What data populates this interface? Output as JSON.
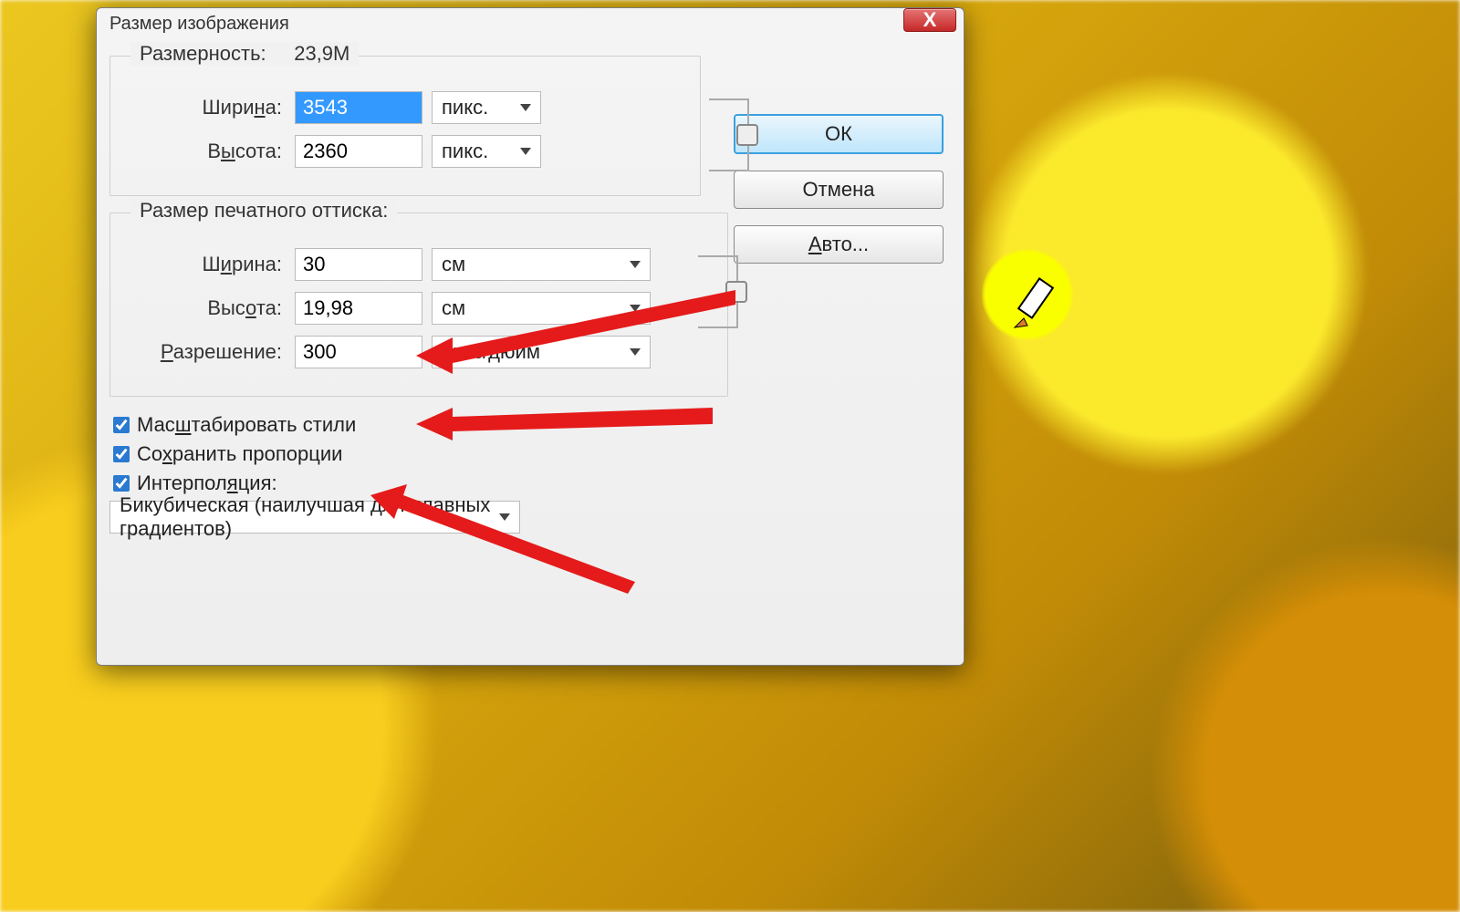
{
  "dialog": {
    "title": "Размер изображения",
    "close": "X",
    "pixelDims": {
      "legend_prefix": "Размерность:",
      "legend_value": "23,9M",
      "width_label": "Ширина:",
      "width_value": "3543",
      "height_label": "Высота:",
      "height_value": "2360",
      "unit": "пикс."
    },
    "printSize": {
      "legend": "Размер печатного оттиска:",
      "width_label": "Ширина:",
      "width_value": "30",
      "height_label": "Высота:",
      "height_value": "19,98",
      "unit": "см",
      "res_label": "Разрешение:",
      "res_value": "300",
      "res_unit": "пикс/дюйм"
    },
    "checks": {
      "scale": "Масштабировать стили",
      "constrain": "Сохранить пропорции",
      "interp_label": "Интерполяция:",
      "interp_value": "Бикубическая (наилучшая для плавных градиентов)"
    },
    "buttons": {
      "ok": "ОК",
      "cancel": "Отмена",
      "auto": "Авто..."
    }
  }
}
